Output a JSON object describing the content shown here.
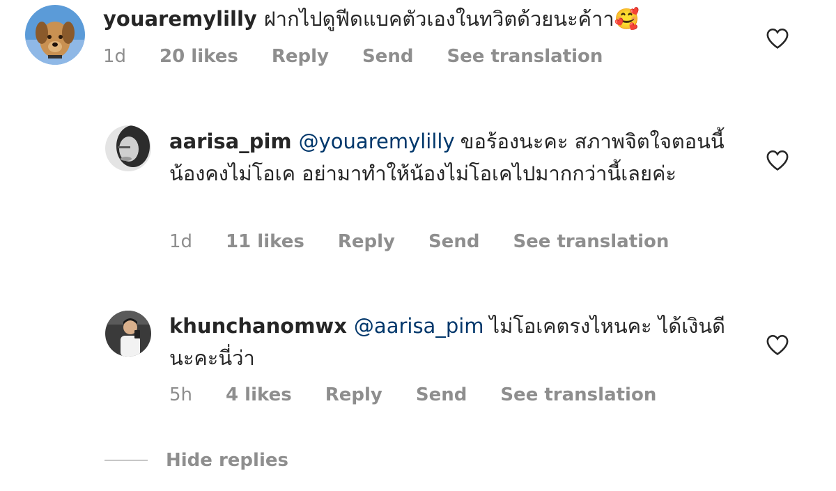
{
  "comments": [
    {
      "username": "youaremylilly",
      "mention": "",
      "text": "ฝากไปดูฟีดแบคตัวเองในทวิตด้วยนะค้าา",
      "emoji": "🥰",
      "time": "1d",
      "likes": "20 likes",
      "reply": "Reply",
      "send": "Send",
      "translate": "See translation",
      "avatar_icon": "dog-photo-avatar"
    },
    {
      "username": "aarisa_pim",
      "mention": "@youaremylilly",
      "text": "ขอร้องนะคะ สภาพจิตใจตอนนี้น้องคงไม่โอเค อย่ามาทำให้น้องไม่โอเคไปมากกว่านี้เลยค่ะ",
      "time": "1d",
      "likes": "11 likes",
      "reply": "Reply",
      "send": "Send",
      "translate": "See translation",
      "avatar_icon": "bw-portrait-avatar"
    },
    {
      "username": "khunchanomwx",
      "mention": "@aarisa_pim",
      "text": "ไม่โอเคตรงไหนคะ ได้เงินดีนะคะนี่ว่า",
      "time": "5h",
      "likes": "4 likes",
      "reply": "Reply",
      "send": "Send",
      "translate": "See translation",
      "avatar_icon": "mirror-selfie-avatar"
    }
  ],
  "hide_replies": "Hide replies",
  "colors": {
    "text": "#262626",
    "meta": "#8e8e8e",
    "mention": "#00376b"
  }
}
